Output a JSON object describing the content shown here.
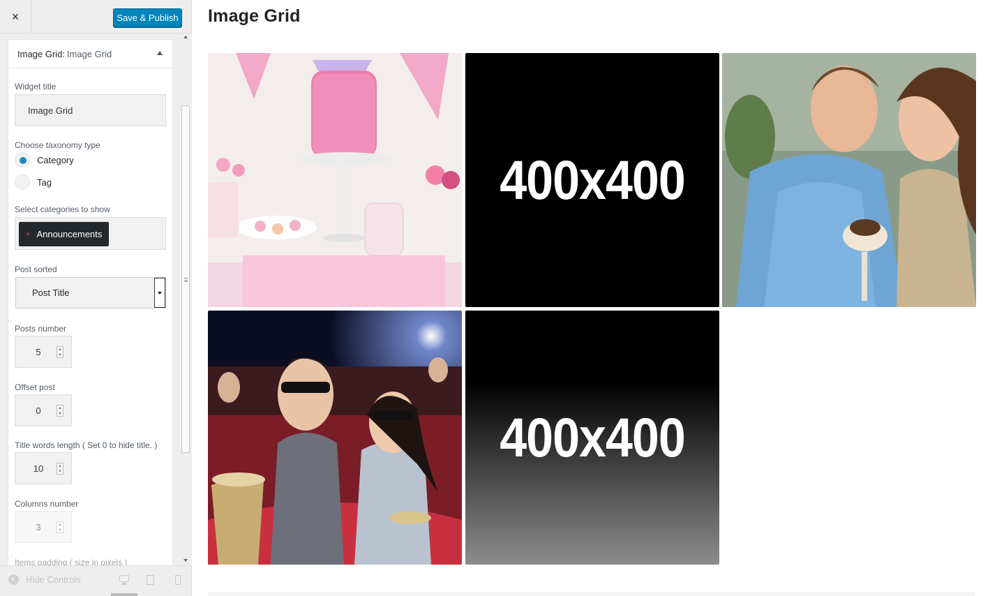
{
  "header": {
    "close_label": "×",
    "publish_label": "Save & Publish"
  },
  "widget": {
    "head_strong": "Image Grid:",
    "head_sub": "Image Grid",
    "title_label": "Widget title",
    "title_value": "Image Grid",
    "taxonomy_label": "Choose taxonomy type",
    "taxonomy_options": [
      {
        "label": "Category",
        "checked": true
      },
      {
        "label": "Tag",
        "checked": false
      }
    ],
    "categories_label": "Select categories to show",
    "categories": [
      {
        "remove": "×",
        "label": "Announcements"
      }
    ],
    "sort_label": "Post sorted",
    "sort_value": "Post Title",
    "posts_number_label": "Posts number",
    "posts_number": "5",
    "offset_label": "Offset post",
    "offset": "0",
    "title_length_label": "Title words length ( Set 0 to hide title. )",
    "title_length": "10",
    "columns_label": "Columns number",
    "columns": "3",
    "padding_label": "Items padding ( size in pixels )"
  },
  "footer": {
    "hide_controls": "Hide Controls"
  },
  "preview": {
    "title": "Image Grid",
    "tiles": [
      {
        "kind": "photo",
        "subject": "pink-cake-dessert-table"
      },
      {
        "kind": "placeholder",
        "text": "400x400"
      },
      {
        "kind": "photo",
        "subject": "couple-kissing"
      },
      {
        "kind": "photo",
        "subject": "cinema-audience-3d-glasses"
      },
      {
        "kind": "placeholder",
        "text": "400x400"
      }
    ]
  },
  "colors": {
    "primary_button": "#0085ba",
    "radio_checked": "#1e8cbe",
    "sidebar_bg": "#eeeeee"
  }
}
